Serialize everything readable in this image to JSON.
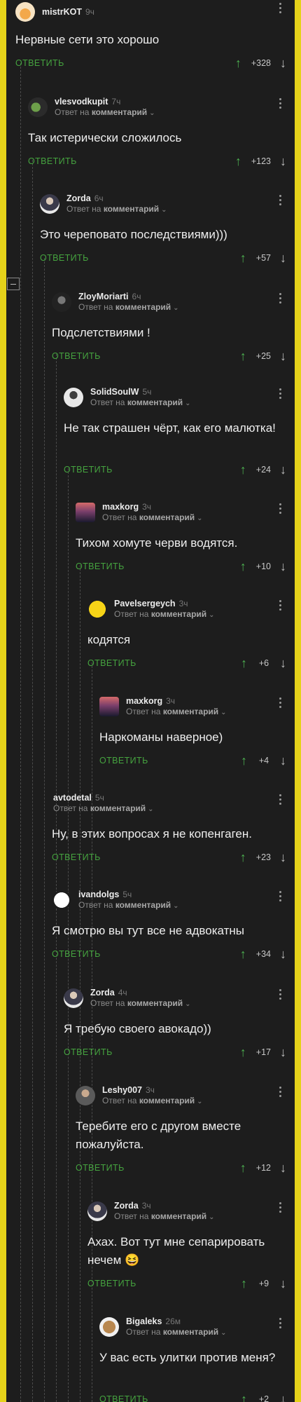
{
  "comments": [
    {
      "author": "mistrKOT",
      "time": "9ч",
      "replyPrefix": "",
      "replyTarget": "",
      "text": "Нервные сети это хорошо",
      "replyLabel": "ОТВЕТИТЬ",
      "score": "+328"
    },
    {
      "author": "vlesvodkupit",
      "time": "7ч",
      "replyPrefix": "Ответ на",
      "replyTarget": "комментарий",
      "text": "Так истерически сложилось",
      "replyLabel": "ОТВЕТИТЬ",
      "score": "+123"
    },
    {
      "author": "Zorda",
      "time": "6ч",
      "replyPrefix": "Ответ на",
      "replyTarget": "комментарий",
      "text": "Это череповато последствиями)))",
      "replyLabel": "ОТВЕТИТЬ",
      "score": "+57"
    },
    {
      "author": "ZloyMoriarti",
      "time": "6ч",
      "replyPrefix": "Ответ на",
      "replyTarget": "комментарий",
      "text": "Подслетствиями !",
      "replyLabel": "ОТВЕТИТЬ",
      "score": "+25"
    },
    {
      "author": "SolidSoulW",
      "time": "5ч",
      "replyPrefix": "Ответ на",
      "replyTarget": "комментарий",
      "text": "Не так страшен чёрт, как его малютка!",
      "replyLabel": "ОТВЕТИТЬ",
      "score": "+24"
    },
    {
      "author": "maxkorg",
      "time": "3ч",
      "replyPrefix": "Ответ на",
      "replyTarget": "комментарий",
      "text": "Тихом хомуте черви водятся.",
      "replyLabel": "ОТВЕТИТЬ",
      "score": "+10"
    },
    {
      "author": "Pavelsergeych",
      "time": "3ч",
      "replyPrefix": "Ответ на",
      "replyTarget": "комментарий",
      "text": "кодятся",
      "replyLabel": "ОТВЕТИТЬ",
      "score": "+6"
    },
    {
      "author": "maxkorg",
      "time": "3ч",
      "replyPrefix": "Ответ на",
      "replyTarget": "комментарий",
      "text": "Наркоманы наверное)",
      "replyLabel": "ОТВЕТИТЬ",
      "score": "+4"
    },
    {
      "author": "avtodetal",
      "time": "5ч",
      "replyPrefix": "Ответ на",
      "replyTarget": "комментарий",
      "text": "Ну, в этих вопросах я не копенгаген.",
      "replyLabel": "ОТВЕТИТЬ",
      "score": "+23"
    },
    {
      "author": "ivandolgs",
      "time": "5ч",
      "replyPrefix": "Ответ на",
      "replyTarget": "комментарий",
      "text": "Я смотрю вы тут все не адвокатны",
      "replyLabel": "ОТВЕТИТЬ",
      "score": "+34"
    },
    {
      "author": "Zorda",
      "time": "4ч",
      "replyPrefix": "Ответ на",
      "replyTarget": "комментарий",
      "text": "Я требую своего авокадо))",
      "replyLabel": "ОТВЕТИТЬ",
      "score": "+17"
    },
    {
      "author": "Leshy007",
      "time": "3ч",
      "replyPrefix": "Ответ на",
      "replyTarget": "комментарий",
      "text": "Теребите его с другом вместе пожалуйста.",
      "replyLabel": "ОТВЕТИТЬ",
      "score": "+12"
    },
    {
      "author": "Zorda",
      "time": "3ч",
      "replyPrefix": "Ответ на",
      "replyTarget": "комментарий",
      "text": "Ахах. Вот тут мне сепарировать нечем 😆",
      "replyLabel": "ОТВЕТИТЬ",
      "score": "+9"
    },
    {
      "author": "Bigaleks",
      "time": "26м",
      "replyPrefix": "Ответ на",
      "replyTarget": "комментарий",
      "text": "У вас есть улитки против меня?",
      "replyLabel": "ОТВЕТИТЬ",
      "score": "+2"
    }
  ],
  "colors": {
    "page": "#e5d21a",
    "background": "#1d1d1d",
    "reply": "#45a33f",
    "upvote": "#4caf50",
    "text": "#eeeeee",
    "muted": "#8a8a8a"
  },
  "icons": {
    "upvote": "arrow-up-icon",
    "downvote": "arrow-down-icon",
    "menu": "more-vertical-icon",
    "collapse": "collapse-minus-icon",
    "expand": "chevron-down-icon"
  }
}
